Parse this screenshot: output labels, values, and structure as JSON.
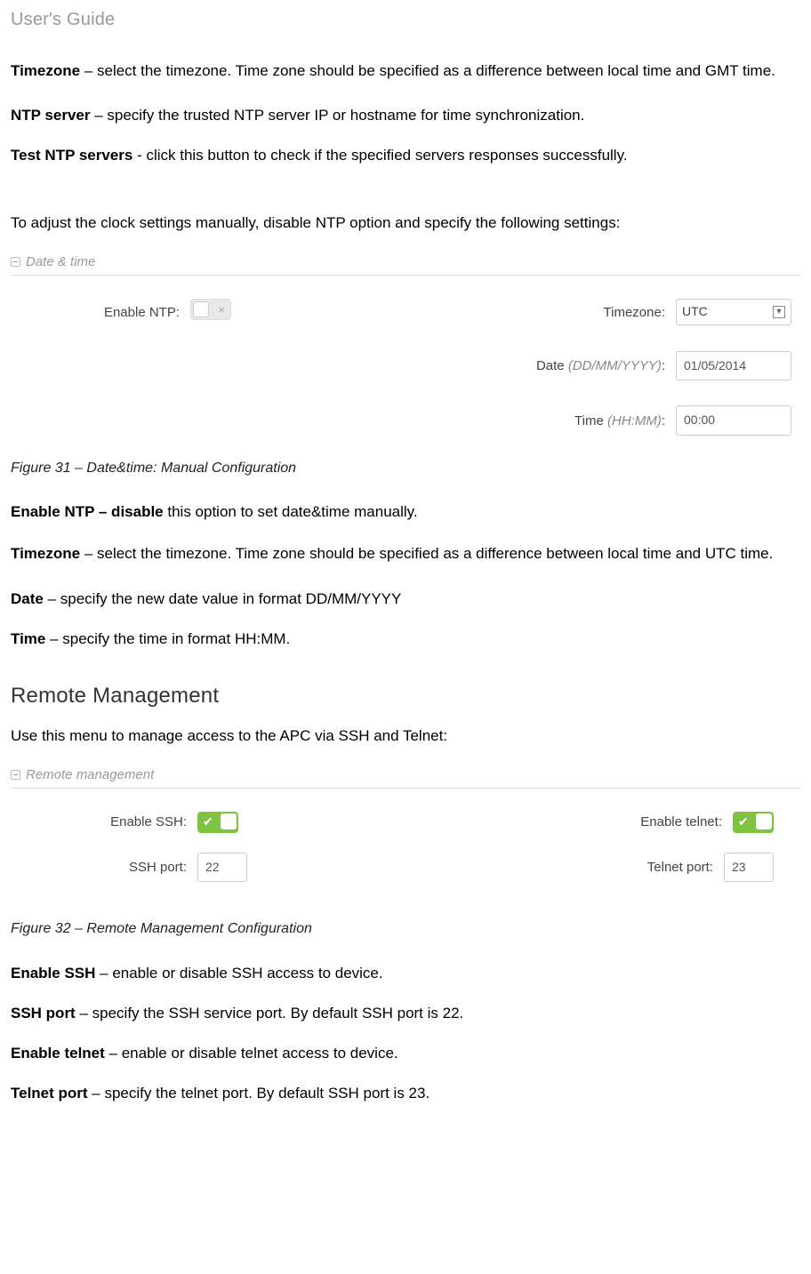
{
  "header": "User's Guide",
  "intro": {
    "timezone_label": "Timezone",
    "timezone_text": " – select the timezone. Time zone should be specified as a difference between local time and GMT time.",
    "ntp_server_label": "NTP server",
    "ntp_server_text": " – specify the trusted NTP server IP or hostname for time synchronization.",
    "test_ntp_label": "Test NTP servers",
    "test_ntp_text": " - click this button to check if the specified servers responses successfully.",
    "manual_intro": "To adjust the clock settings manually, disable NTP option and specify the following settings:"
  },
  "datetime_panel": {
    "title": "Date & time",
    "enable_ntp_label": "Enable NTP:",
    "timezone_label": "Timezone:",
    "timezone_value": "UTC",
    "date_label_prefix": "Date ",
    "date_label_hint": "(DD/MM/YYYY)",
    "date_label_suffix": ":",
    "date_value": "01/05/2014",
    "time_label_prefix": "Time ",
    "time_label_hint": "(HH:MM)",
    "time_label_suffix": ":",
    "time_value": "00:00"
  },
  "fig31": "Figure 31 – Date&time: Manual Configuration",
  "after_fig31": {
    "enable_ntp_label": "Enable NTP – disable",
    "enable_ntp_text": " this option to set date&time manually.",
    "timezone_label": "Timezone",
    "timezone_text": " – select the timezone. Time zone should be specified as a difference between local time and UTC time.",
    "date_label": "Date",
    "date_text": " – specify the new date value in format DD/MM/YYYY",
    "time_label": "Time",
    "time_text": " – specify the time in format  HH:MM."
  },
  "remote_heading": "Remote Management",
  "remote_intro": "Use this menu to manage access to the APC via SSH and Telnet:",
  "remote_panel": {
    "title": "Remote management",
    "enable_ssh_label": "Enable SSH:",
    "ssh_port_label": "SSH port:",
    "ssh_port_value": "22",
    "enable_telnet_label": "Enable telnet:",
    "telnet_port_label": "Telnet port:",
    "telnet_port_value": "23"
  },
  "fig32": "Figure 32 – Remote Management Configuration",
  "after_fig32": {
    "enable_ssh_label": "Enable SSH",
    "enable_ssh_text": " – enable or disable SSH access to device.",
    "ssh_port_label": "SSH port",
    "ssh_port_text": " – specify the SSH service port. By default SSH port is 22.",
    "enable_telnet_label": "Enable telnet",
    "enable_telnet_text": " – enable or disable telnet access to device.",
    "telnet_port_label": "Telnet port",
    "telnet_port_text": " – specify the telnet port. By default SSH port is 23."
  }
}
